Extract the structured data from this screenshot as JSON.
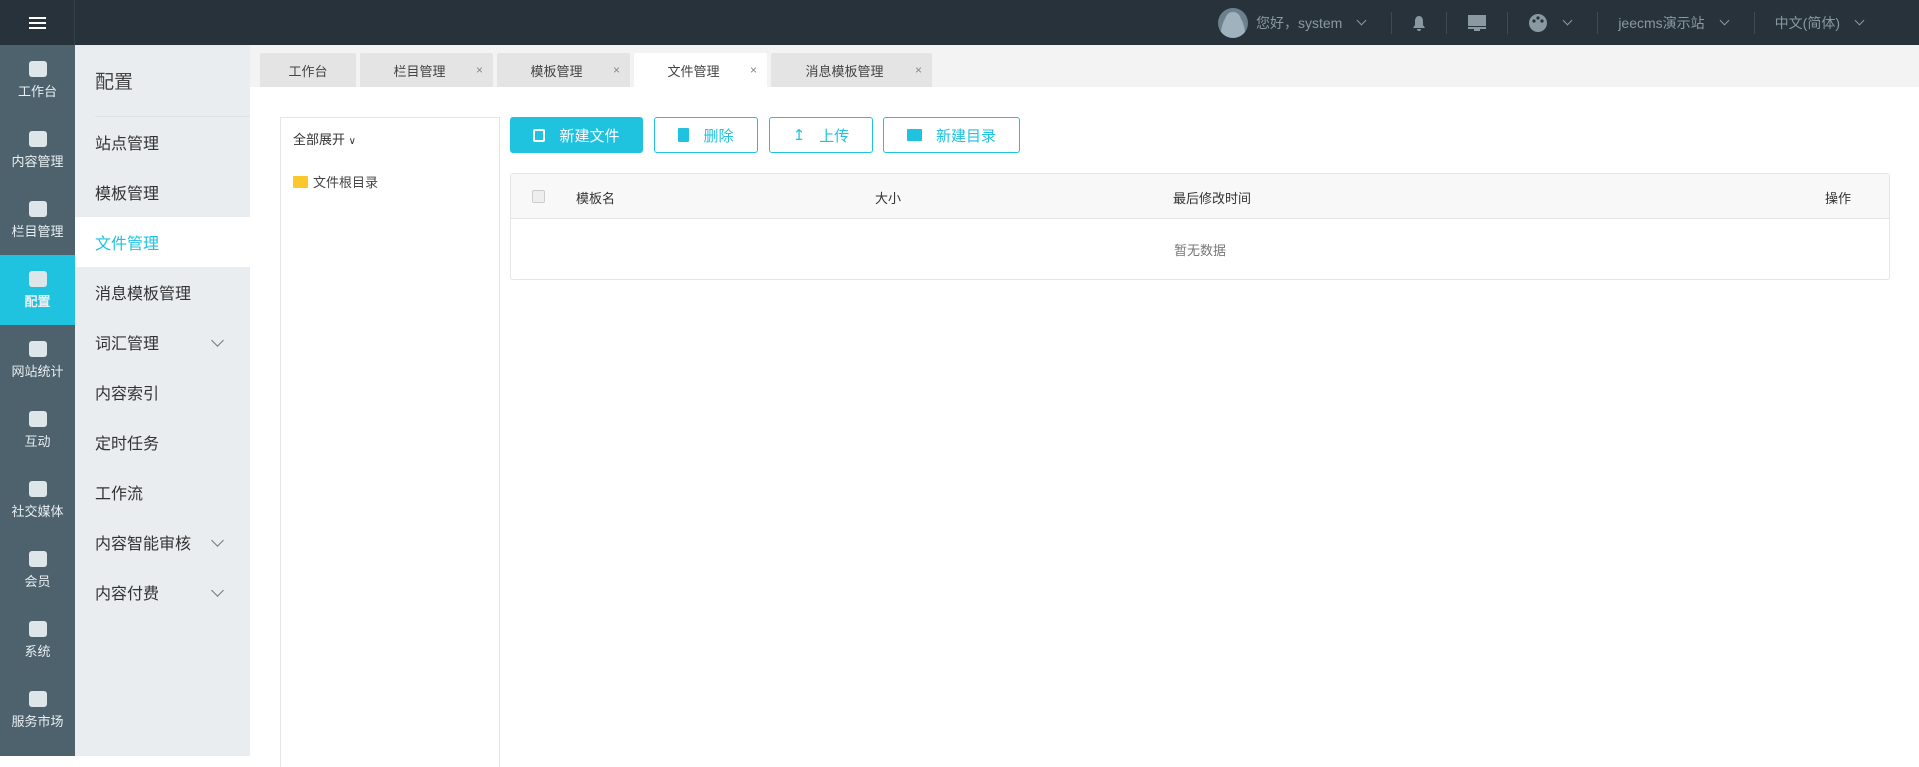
{
  "topbar": {
    "greeting": "您好，system",
    "site": "jeecms演示站",
    "language": "中文(简体)"
  },
  "iconbar": [
    {
      "label": "工作台",
      "icon": "home-icon"
    },
    {
      "label": "内容管理",
      "icon": "content-icon"
    },
    {
      "label": "栏目管理",
      "icon": "layers-icon"
    },
    {
      "label": "配置",
      "icon": "cube-icon",
      "active": true
    },
    {
      "label": "网站统计",
      "icon": "chart-icon"
    },
    {
      "label": "互动",
      "icon": "chat-icon"
    },
    {
      "label": "社交媒体",
      "icon": "social-icon"
    },
    {
      "label": "会员",
      "icon": "member-icon"
    },
    {
      "label": "系统",
      "icon": "gear-icon"
    },
    {
      "label": "服务市场",
      "icon": "service-icon"
    }
  ],
  "submenu": {
    "title": "配置",
    "items": [
      {
        "label": "站点管理"
      },
      {
        "label": "模板管理"
      },
      {
        "label": "文件管理",
        "active": true
      },
      {
        "label": "消息模板管理"
      },
      {
        "label": "词汇管理",
        "expandable": true
      },
      {
        "label": "内容索引"
      },
      {
        "label": "定时任务"
      },
      {
        "label": "工作流"
      },
      {
        "label": "内容智能审核",
        "expandable": true
      },
      {
        "label": "内容付费",
        "expandable": true
      }
    ]
  },
  "tabs": [
    {
      "label": "工作台"
    },
    {
      "label": "栏目管理",
      "close": "×"
    },
    {
      "label": "模板管理",
      "close": "×"
    },
    {
      "label": "文件管理",
      "close": "×",
      "active": true
    },
    {
      "label": "消息模板管理",
      "close": "×"
    }
  ],
  "tree": {
    "expand_all": "全部展开",
    "root": "文件根目录"
  },
  "toolbar": {
    "new_file": "新建文件",
    "delete": "删除",
    "upload": "上传",
    "new_dir": "新建目录"
  },
  "table": {
    "columns": [
      "模板名",
      "大小",
      "最后修改时间",
      "操作"
    ],
    "empty": "暂无数据"
  },
  "colors": {
    "accent": "#1fc2df",
    "topbar": "#27323a",
    "iconbar": "#4d626d"
  }
}
